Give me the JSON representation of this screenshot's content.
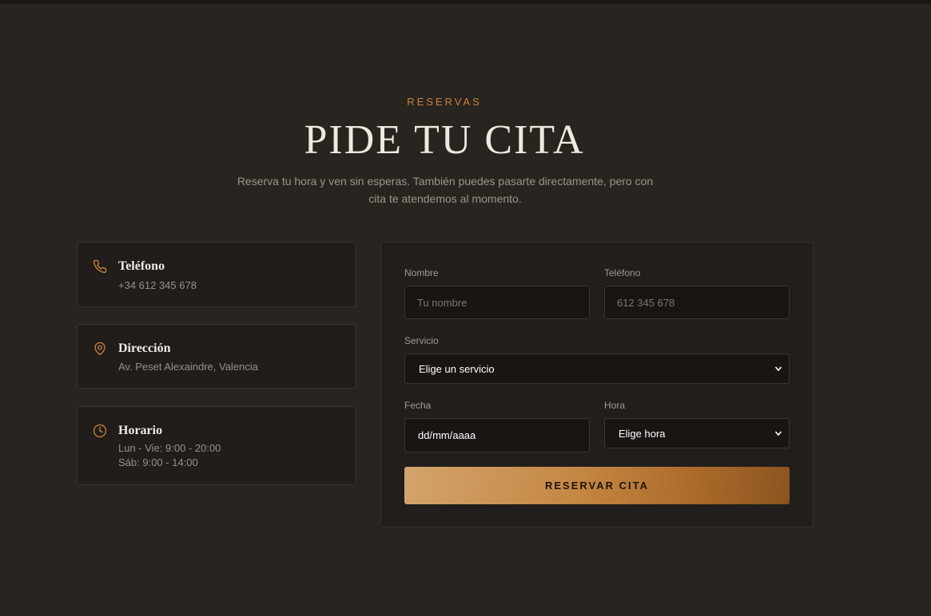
{
  "section": {
    "eyebrow": "RESERVAS",
    "title": "PIDE TU CITA",
    "subtitle": "Reserva tu hora y ven sin esperas. También puedes pasarte directamente, pero con cita te atendemos al momento."
  },
  "contact": {
    "phone": {
      "label": "Teléfono",
      "value": "+34 612 345 678",
      "icon": "phone-icon"
    },
    "address": {
      "label": "Dirección",
      "value": "Av. Peset Alexaindre, Valencia",
      "icon": "map-pin-icon"
    },
    "hours": {
      "label": "Horario",
      "lines": [
        "Lun - Vie: 9:00 - 20:00",
        "Sáb: 9:00 - 14:00"
      ],
      "icon": "clock-icon"
    }
  },
  "form": {
    "name": {
      "label": "Nombre",
      "placeholder": "Tu nombre",
      "value": ""
    },
    "phone": {
      "label": "Teléfono",
      "placeholder": "612 345 678",
      "value": ""
    },
    "service": {
      "label": "Servicio",
      "selected": "Elige un servicio"
    },
    "date": {
      "label": "Fecha",
      "value": "dd/mm/aaaa"
    },
    "time": {
      "label": "Hora",
      "selected": "Elige hora"
    },
    "submit_label": "RESERVAR CITA"
  },
  "colors": {
    "background": "#28241f",
    "card": "#201d1a",
    "accent": "#c8823e",
    "text": "#efe9df",
    "muted": "#9d958a"
  }
}
